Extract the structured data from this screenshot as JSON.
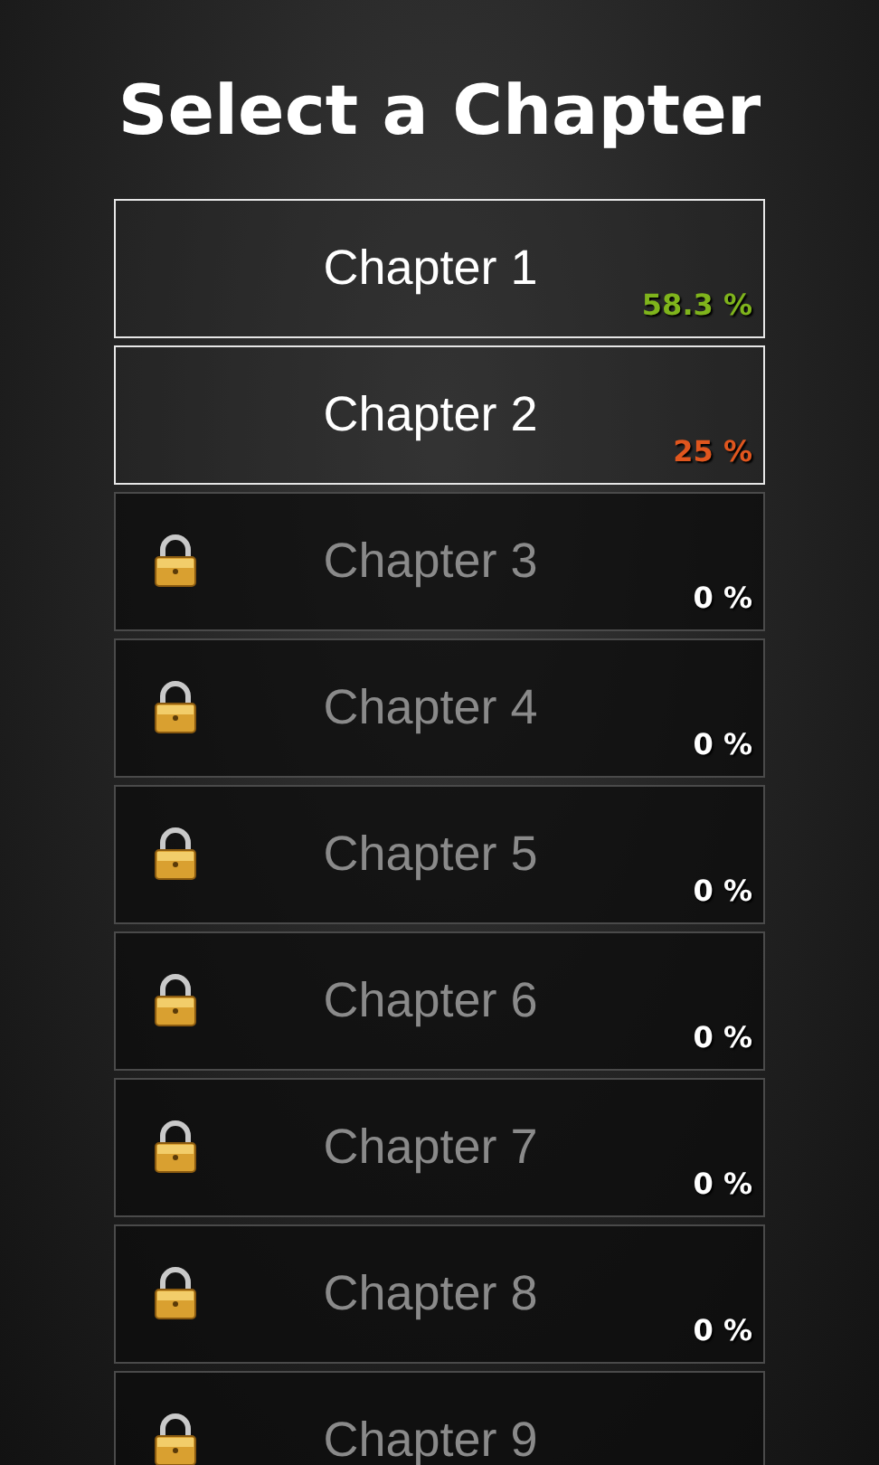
{
  "title": "Select a Chapter",
  "chapters": [
    {
      "label": "Chapter 1",
      "locked": false,
      "progress": "58.3 %",
      "color": "#7fb41c"
    },
    {
      "label": "Chapter 2",
      "locked": false,
      "progress": "25 %",
      "color": "#e0561e"
    },
    {
      "label": "Chapter 3",
      "locked": true,
      "progress": "0 %",
      "color": "#ffffff"
    },
    {
      "label": "Chapter 4",
      "locked": true,
      "progress": "0 %",
      "color": "#ffffff"
    },
    {
      "label": "Chapter 5",
      "locked": true,
      "progress": "0 %",
      "color": "#ffffff"
    },
    {
      "label": "Chapter 6",
      "locked": true,
      "progress": "0 %",
      "color": "#ffffff"
    },
    {
      "label": "Chapter 7",
      "locked": true,
      "progress": "0 %",
      "color": "#ffffff"
    },
    {
      "label": "Chapter 8",
      "locked": true,
      "progress": "0 %",
      "color": "#ffffff"
    },
    {
      "label": "Chapter 9",
      "locked": true
    }
  ]
}
